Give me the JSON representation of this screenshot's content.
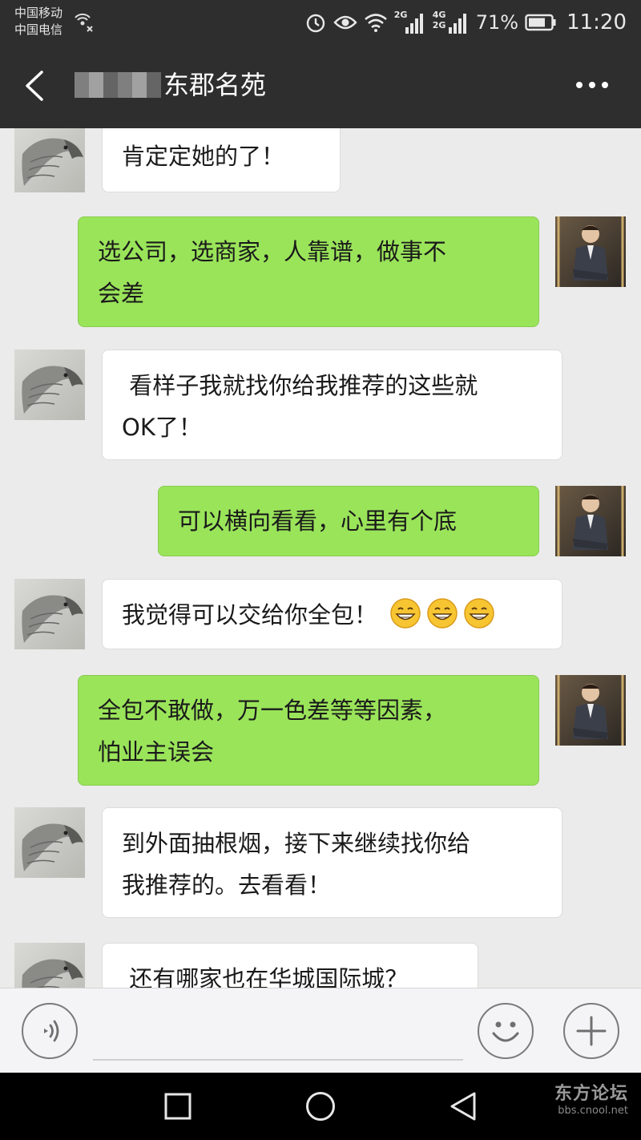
{
  "status_bar": {
    "carrier_1": "中国移动",
    "carrier_2": "中国电信",
    "network_a": "2G",
    "network_b": "4G",
    "network_c": "2G",
    "battery": "71%",
    "time": "11:20"
  },
  "header": {
    "title": "东郡名苑"
  },
  "messages": [
    {
      "side": "in",
      "text": "肯定定她的了！"
    },
    {
      "side": "out",
      "line1": "选公司，选商家，人靠谱，做事不",
      "line2": "会差"
    },
    {
      "side": "in",
      "line1": " 看样子我就找你给我推荐的这些就",
      "line2": "OK了！"
    },
    {
      "side": "out",
      "text": "可以横向看看，心里有个底"
    },
    {
      "side": "in",
      "text": "我觉得可以交给你全包！",
      "emoji": "grinning-face-icon",
      "emoji_count": 3
    },
    {
      "side": "out",
      "line1": "全包不敢做，万一色差等等因素，",
      "line2": "怕业主误会"
    },
    {
      "side": "in",
      "line1": "到外面抽根烟，接下来继续找你给",
      "line2": "我推荐的。去看看！"
    },
    {
      "side": "in",
      "text": " 还有哪家也在华城国际城？"
    }
  ],
  "watermark": {
    "main": "东方论坛",
    "sub": "bbs.cnool.net"
  },
  "colors": {
    "header_bg": "#2e2e2e",
    "chat_bg": "#ebebeb",
    "outgoing_bubble": "#9ae45a",
    "incoming_bubble": "#ffffff"
  }
}
